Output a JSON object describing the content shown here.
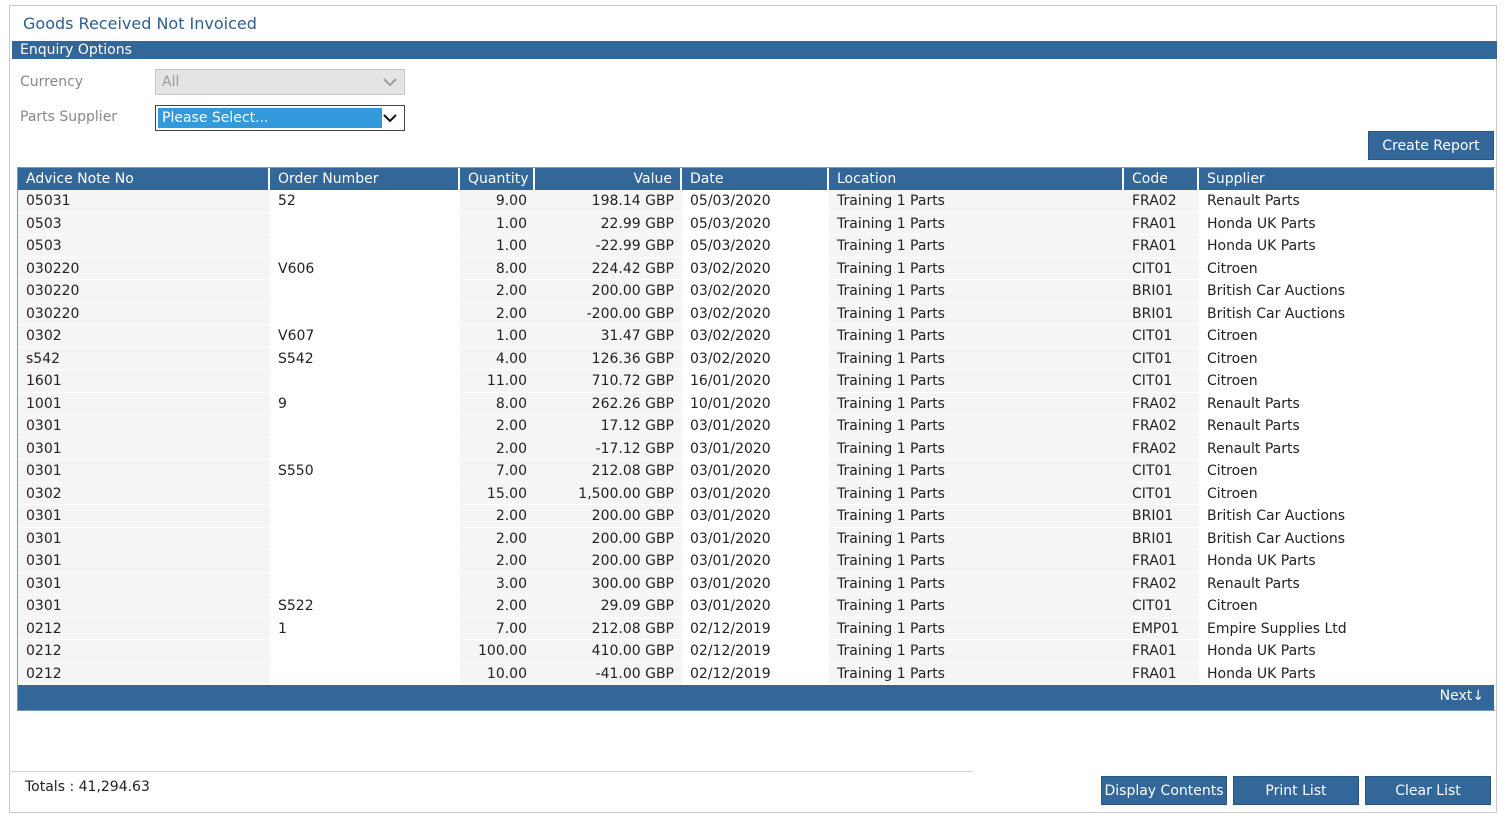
{
  "page": {
    "title": "Goods Received Not Invoiced"
  },
  "enquiry": {
    "section_label": "Enquiry Options",
    "currency_label": "Currency",
    "currency_value": "All",
    "supplier_label": "Parts Supplier",
    "supplier_value": "Please Select..."
  },
  "actions": {
    "create_report": "Create Report",
    "next": "Next"
  },
  "table": {
    "headers": [
      "Advice Note No",
      "Order Number",
      "Quantity",
      "Value",
      "Date",
      "Location",
      "Code",
      "Supplier"
    ],
    "rows": [
      [
        "05031",
        "52",
        "9.00",
        "198.14 GBP",
        "05/03/2020",
        "Training 1 Parts",
        "FRA02",
        "Renault Parts"
      ],
      [
        "0503",
        "",
        "1.00",
        "22.99 GBP",
        "05/03/2020",
        "Training 1 Parts",
        "FRA01",
        "Honda UK Parts"
      ],
      [
        "0503",
        "",
        "1.00",
        "-22.99 GBP",
        "05/03/2020",
        "Training 1 Parts",
        "FRA01",
        "Honda UK Parts"
      ],
      [
        "030220",
        "V606",
        "8.00",
        "224.42 GBP",
        "03/02/2020",
        "Training 1 Parts",
        "CIT01",
        "Citroen"
      ],
      [
        "030220",
        "",
        "2.00",
        "200.00 GBP",
        "03/02/2020",
        "Training 1 Parts",
        "BRI01",
        "British Car Auctions"
      ],
      [
        "030220",
        "",
        "2.00",
        "-200.00 GBP",
        "03/02/2020",
        "Training 1 Parts",
        "BRI01",
        "British Car Auctions"
      ],
      [
        "0302",
        "V607",
        "1.00",
        "31.47 GBP",
        "03/02/2020",
        "Training 1 Parts",
        "CIT01",
        "Citroen"
      ],
      [
        "s542",
        "S542",
        "4.00",
        "126.36 GBP",
        "03/02/2020",
        "Training 1 Parts",
        "CIT01",
        "Citroen"
      ],
      [
        "1601",
        "",
        "11.00",
        "710.72 GBP",
        "16/01/2020",
        "Training 1 Parts",
        "CIT01",
        "Citroen"
      ],
      [
        "1001",
        "9",
        "8.00",
        "262.26 GBP",
        "10/01/2020",
        "Training 1 Parts",
        "FRA02",
        "Renault Parts"
      ],
      [
        "0301",
        "",
        "2.00",
        "17.12 GBP",
        "03/01/2020",
        "Training 1 Parts",
        "FRA02",
        "Renault Parts"
      ],
      [
        "0301",
        "",
        "2.00",
        "-17.12 GBP",
        "03/01/2020",
        "Training 1 Parts",
        "FRA02",
        "Renault Parts"
      ],
      [
        "0301",
        "S550",
        "7.00",
        "212.08 GBP",
        "03/01/2020",
        "Training 1 Parts",
        "CIT01",
        "Citroen"
      ],
      [
        "0302",
        "",
        "15.00",
        "1,500.00 GBP",
        "03/01/2020",
        "Training 1 Parts",
        "CIT01",
        "Citroen"
      ],
      [
        "0301",
        "",
        "2.00",
        "200.00 GBP",
        "03/01/2020",
        "Training 1 Parts",
        "BRI01",
        "British Car Auctions"
      ],
      [
        "0301",
        "",
        "2.00",
        "200.00 GBP",
        "03/01/2020",
        "Training 1 Parts",
        "BRI01",
        "British Car Auctions"
      ],
      [
        "0301",
        "",
        "2.00",
        "200.00 GBP",
        "03/01/2020",
        "Training 1 Parts",
        "FRA01",
        "Honda UK Parts"
      ],
      [
        "0301",
        "",
        "3.00",
        "300.00 GBP",
        "03/01/2020",
        "Training 1 Parts",
        "FRA02",
        "Renault Parts"
      ],
      [
        "0301",
        "S522",
        "2.00",
        "29.09 GBP",
        "03/01/2020",
        "Training 1 Parts",
        "CIT01",
        "Citroen"
      ],
      [
        "0212",
        "1",
        "7.00",
        "212.08 GBP",
        "02/12/2019",
        "Training 1 Parts",
        "EMP01",
        "Empire Supplies Ltd"
      ],
      [
        "0212",
        "",
        "100.00",
        "410.00 GBP",
        "02/12/2019",
        "Training 1 Parts",
        "FRA01",
        "Honda UK Parts"
      ],
      [
        "0212",
        "",
        "10.00",
        "-41.00 GBP",
        "02/12/2019",
        "Training 1 Parts",
        "FRA01",
        "Honda UK Parts"
      ]
    ]
  },
  "footer": {
    "totals_label": "Totals",
    "totals_value": "41,294.63",
    "display_contents": "Display Contents",
    "print_list": "Print List",
    "clear_list": "Clear List"
  },
  "colors": {
    "accent": "#336699",
    "highlight": "#3399dd",
    "title": "#2e5e8f"
  },
  "icons": {
    "dropdown": "chevron-down-icon",
    "next": "arrow-down-icon"
  }
}
